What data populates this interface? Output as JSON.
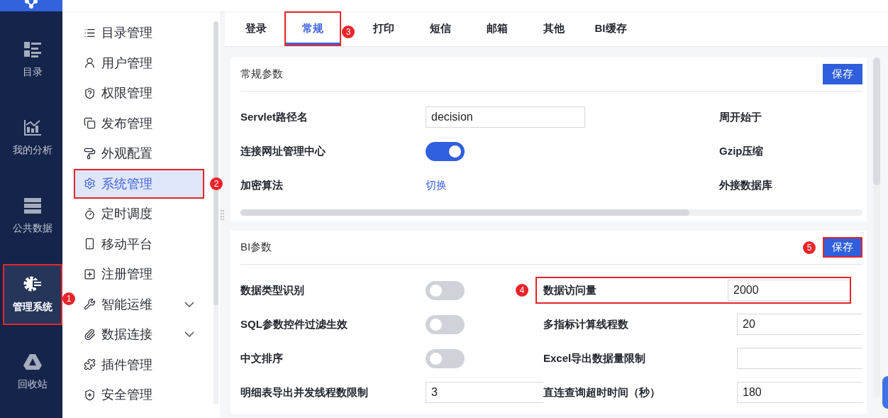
{
  "nav": [
    {
      "label": "目录",
      "selected": false
    },
    {
      "label": "我的分析",
      "selected": false
    },
    {
      "label": "公共数据",
      "selected": false
    },
    {
      "label": "管理系统",
      "selected": true,
      "highlighted": true,
      "callout": "1"
    },
    {
      "label": "回收站",
      "selected": false
    }
  ],
  "menu": [
    {
      "label": "目录管理",
      "selected": false
    },
    {
      "label": "用户管理",
      "selected": false
    },
    {
      "label": "权限管理",
      "selected": false
    },
    {
      "label": "发布管理",
      "selected": false
    },
    {
      "label": "外观配置",
      "selected": false
    },
    {
      "label": "系统管理",
      "selected": true,
      "highlighted": true,
      "callout": "2"
    },
    {
      "label": "定时调度",
      "selected": false
    },
    {
      "label": "移动平台",
      "selected": false
    },
    {
      "label": "注册管理",
      "selected": false
    },
    {
      "label": "智能运维",
      "selected": false,
      "expanded": false
    },
    {
      "label": "数据连接",
      "selected": false,
      "expanded": false
    },
    {
      "label": "插件管理",
      "selected": false
    },
    {
      "label": "安全管理",
      "selected": false
    }
  ],
  "tabs": [
    {
      "label": "登录",
      "selected": false
    },
    {
      "label": "常规",
      "selected": true,
      "highlighted": true,
      "callout": "3"
    },
    {
      "label": "打印",
      "selected": false
    },
    {
      "label": "短信",
      "selected": false
    },
    {
      "label": "邮箱",
      "selected": false
    },
    {
      "label": "其他",
      "selected": false
    },
    {
      "label": "BI缓存",
      "selected": false
    }
  ],
  "sections": [
    {
      "title": "常规参数",
      "kind": "wide",
      "save_button": {
        "label": "保存",
        "highlighted": false
      },
      "rows": [
        [
          {
            "label": "Servlet路径名",
            "control": {
              "kind": "input",
              "value": "decision"
            }
          },
          {
            "label": "周开始于"
          }
        ],
        [
          {
            "label": "连接网址管理中心",
            "control": {
              "kind": "switch",
              "on": true
            }
          },
          {
            "label": "Gzip压缩"
          }
        ],
        [
          {
            "label": "加密算法",
            "control": {
              "kind": "link",
              "text": "切换"
            }
          },
          {
            "label": "外接数据库"
          }
        ]
      ]
    },
    {
      "title": "BI参数",
      "kind": "compact",
      "save_button": {
        "label": "保存",
        "highlighted": true,
        "callout": "5"
      },
      "rows": [
        [
          {
            "label": "数据类型识别",
            "control": {
              "kind": "switch",
              "on": false
            }
          },
          {
            "label": "数据访问量",
            "control": {
              "kind": "input",
              "value": "2000"
            },
            "highlighted": true,
            "callout": "4"
          }
        ],
        [
          {
            "label": "SQL参数控件过滤生效",
            "control": {
              "kind": "switch",
              "on": false
            }
          },
          {
            "label": "多指标计算线程数",
            "control": {
              "kind": "input",
              "value": "20"
            }
          }
        ],
        [
          {
            "label": "中文排序",
            "control": {
              "kind": "switch",
              "on": false
            }
          },
          {
            "label": "Excel导出数据量限制",
            "control": {
              "kind": "input"
            }
          }
        ],
        [
          {
            "label": "明细表导出并发线程数限制",
            "control": {
              "kind": "input",
              "value": "3"
            }
          },
          {
            "label": "直连查询超时时间（秒）",
            "control": {
              "kind": "input",
              "value": "180"
            }
          }
        ]
      ]
    }
  ]
}
